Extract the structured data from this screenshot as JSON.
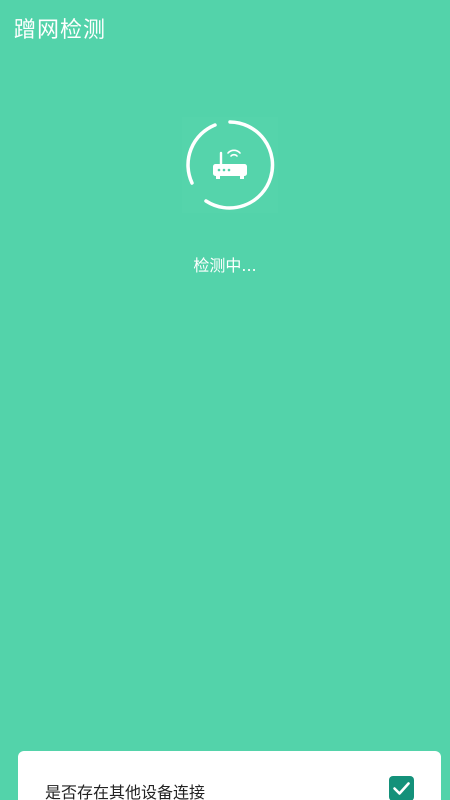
{
  "header": {
    "title": "蹭网检测"
  },
  "scan": {
    "status_text": "检测中...",
    "icon": "router-icon"
  },
  "result_item": {
    "label": "是否存在其他设备连接",
    "checked": true,
    "icon": "checkmark-icon"
  },
  "colors": {
    "background": "#53d3aa",
    "card": "#ffffff",
    "checkbox": "#14917a"
  }
}
